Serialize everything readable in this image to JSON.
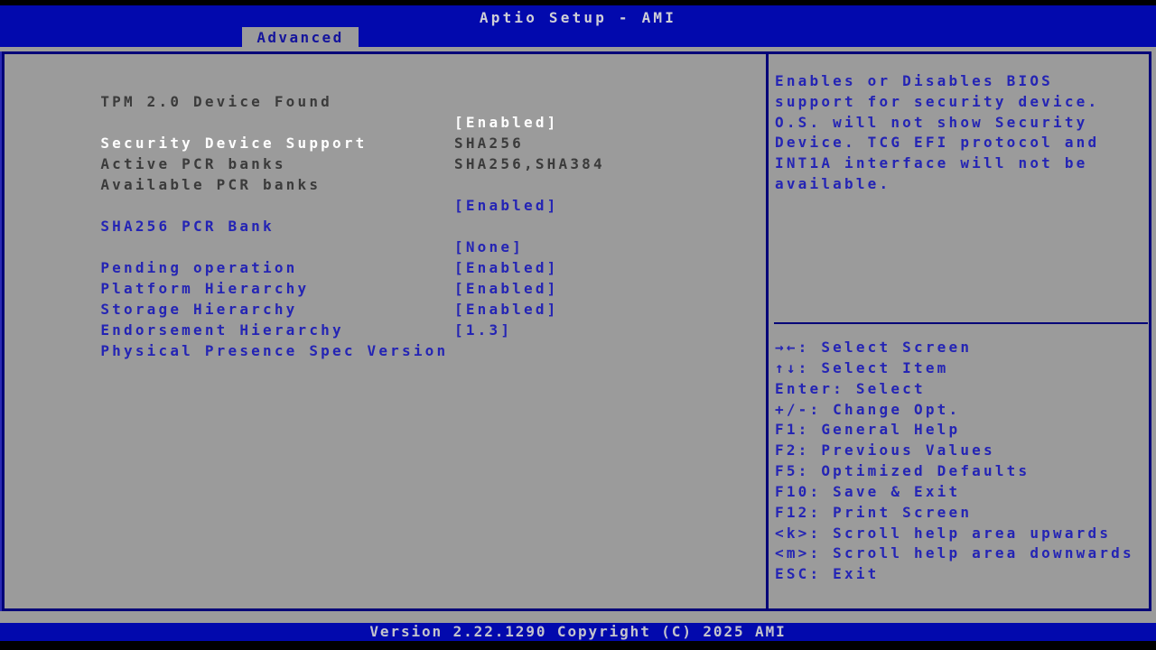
{
  "header": {
    "title": "Aptio Setup - AMI",
    "tab": "Advanced"
  },
  "main": {
    "rows": [
      {
        "label": "TPM 2.0 Device Found",
        "value": "",
        "state": "info"
      },
      {
        "label": "Security Device Support",
        "value": "[Enabled]",
        "state": "selected"
      },
      {
        "label": "Active PCR banks",
        "value": "SHA256",
        "state": "info"
      },
      {
        "label": "Available PCR banks",
        "value": "SHA256,SHA384",
        "state": "info"
      },
      {
        "label": "SHA256 PCR Bank",
        "value": "[Enabled]",
        "state": "option"
      },
      {
        "label": "Pending operation",
        "value": "[None]",
        "state": "option"
      },
      {
        "label": "Platform Hierarchy",
        "value": "[Enabled]",
        "state": "option"
      },
      {
        "label": "Storage Hierarchy",
        "value": "[Enabled]",
        "state": "option"
      },
      {
        "label": "Endorsement Hierarchy",
        "value": "[Enabled]",
        "state": "option"
      },
      {
        "label": "Physical Presence Spec Version",
        "value": "[1.3]",
        "state": "option"
      }
    ]
  },
  "help": {
    "description": "Enables or Disables BIOS\nsupport for security device.\nO.S. will not show Security\nDevice. TCG EFI protocol and\nINT1A interface will not be\navailable.",
    "keys": [
      "→←: Select Screen",
      "↑↓: Select Item",
      "Enter: Select",
      "+/-: Change Opt.",
      "F1: General Help",
      "F2: Previous Values",
      "F5: Optimized Defaults",
      "F10: Save & Exit",
      "F12: Print Screen",
      "<k>: Scroll help area upwards",
      "<m>: Scroll help area downwards",
      "ESC: Exit"
    ]
  },
  "footer": {
    "version_line": "Version 2.22.1290 Copyright (C) 2025 AMI"
  },
  "colors": {
    "header_blue": "#0209ad",
    "border_navy": "#000078",
    "background_gray": "#9b9b9b",
    "option_blue": "#2424b4",
    "selected_white": "#ffffff",
    "info_gray": "#3b3b3b"
  }
}
